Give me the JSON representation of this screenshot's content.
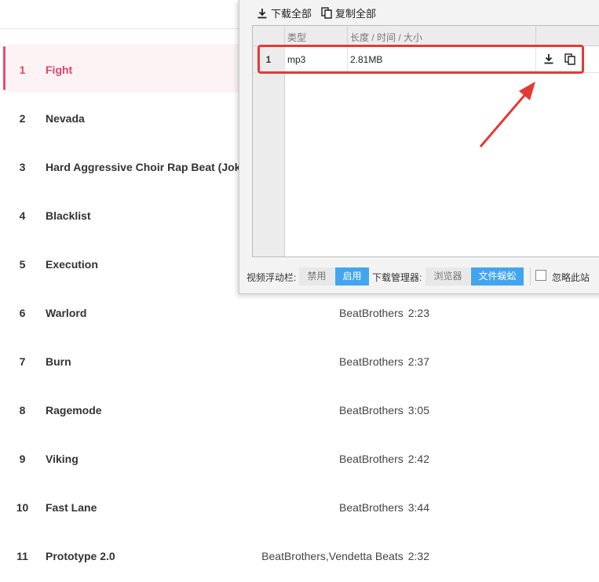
{
  "tracks": [
    {
      "num": "1",
      "title": "Fight",
      "artist": "",
      "duration": "",
      "active": true
    },
    {
      "num": "2",
      "title": "Nevada",
      "artist": "",
      "duration": ""
    },
    {
      "num": "3",
      "title": "Hard Aggressive Choir Rap Beat (Joker)",
      "artist": "",
      "duration": ""
    },
    {
      "num": "4",
      "title": "Blacklist",
      "artist": "",
      "duration": ""
    },
    {
      "num": "5",
      "title": "Execution",
      "artist": "",
      "duration": ""
    },
    {
      "num": "6",
      "title": "Warlord",
      "artist": "BeatBrothers",
      "duration": "2:23"
    },
    {
      "num": "7",
      "title": "Burn",
      "artist": "BeatBrothers",
      "duration": "2:37"
    },
    {
      "num": "8",
      "title": "Ragemode",
      "artist": "BeatBrothers",
      "duration": "3:05"
    },
    {
      "num": "9",
      "title": "Viking",
      "artist": "BeatBrothers",
      "duration": "2:42"
    },
    {
      "num": "10",
      "title": "Fast Lane",
      "artist": "BeatBrothers",
      "duration": "3:44"
    },
    {
      "num": "11",
      "title": "Prototype 2.0",
      "artist": "BeatBrothers,Vendetta Beats",
      "duration": "2:32"
    }
  ],
  "popup": {
    "toolbar": {
      "download_all": "下载全部",
      "copy_all": "复制全部"
    },
    "table": {
      "headers": [
        "类型",
        "长度 / 时间 / 大小"
      ],
      "rows": [
        {
          "num": "1",
          "type": "mp3",
          "size": "2.81MB"
        }
      ]
    },
    "footer": {
      "video_bar_label": "视频浮动栏:",
      "disable": "禁用",
      "enable": "启用",
      "download_manager_label": "下载管理器:",
      "browser": "浏览器",
      "file_manager": "文件蜈蚣",
      "ignore_site": "忽略此站"
    }
  },
  "colors": {
    "active_text": "#e8436a",
    "accent_blue": "#43a5f0",
    "highlight_red": "#e53935"
  }
}
